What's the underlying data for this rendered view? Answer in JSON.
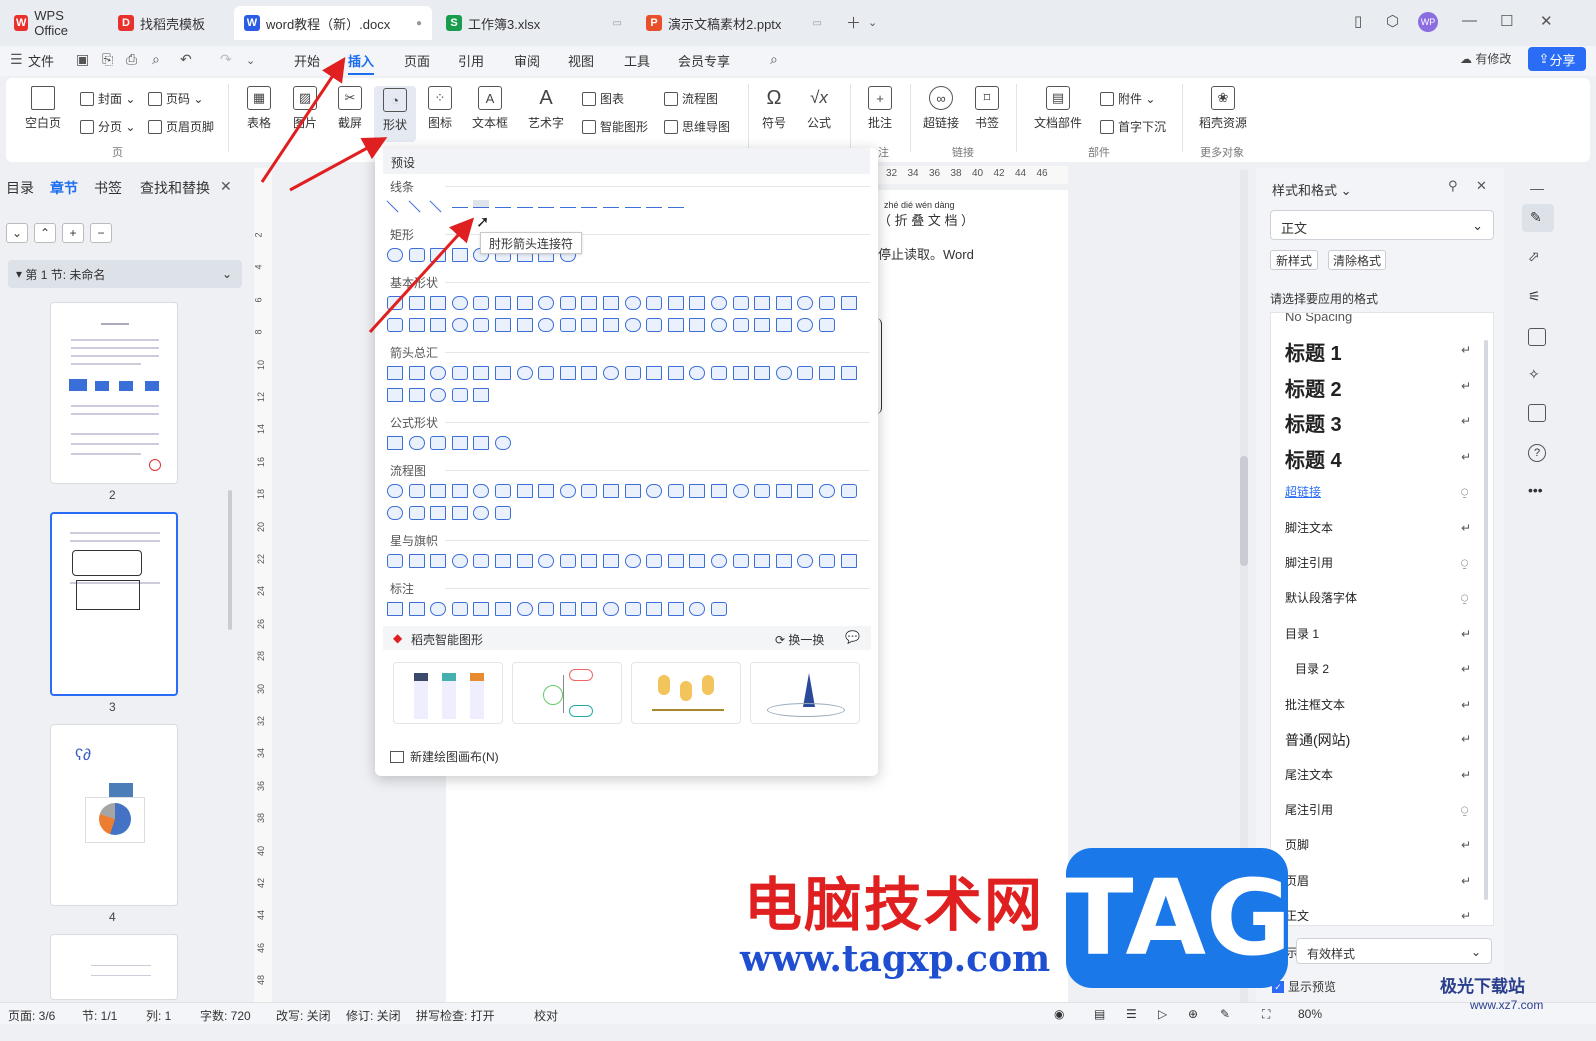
{
  "tabs": [
    {
      "label": "WPS Office",
      "color": "#e8302c"
    },
    {
      "label": "找稻壳模板",
      "color": "#e8302c"
    },
    {
      "label": "word教程（新）.docx",
      "color": "#2b5ce6"
    },
    {
      "label": "工作簿3.xlsx",
      "color": "#1a9c4f"
    },
    {
      "label": "演示文稿素材2.pptx",
      "color": "#e8502c"
    }
  ],
  "menu": {
    "file": "文件",
    "items": [
      "开始",
      "插入",
      "页面",
      "引用",
      "审阅",
      "视图",
      "工具",
      "会员专享"
    ],
    "modified": "有修改",
    "share": "分享"
  },
  "ribbon": {
    "blank_page": "空白页",
    "cover": "封面",
    "page_break": "分页",
    "page_number": "页码",
    "header_footer": "页眉页脚",
    "group_page": "页",
    "table": "表格",
    "picture": "图片",
    "screenshot": "截屏",
    "shape": "形状",
    "icon": "图标",
    "textbox": "文本框",
    "wordart": "艺术字",
    "chart": "图表",
    "smartart": "智能图形",
    "flowchart": "流程图",
    "mindmap": "思维导图",
    "symbol": "符号",
    "formula": "公式",
    "comment": "批注",
    "group_comment": "注",
    "hyperlink": "超链接",
    "bookmark": "书签",
    "group_link": "链接",
    "doc_parts": "文档部件",
    "attachment": "附件",
    "dropcap": "首字下沉",
    "group_parts": "部件",
    "docer_resource": "稻壳资源",
    "group_more": "更多对象"
  },
  "nav": {
    "tabs": [
      "目录",
      "章节",
      "书签",
      "查找和替换"
    ],
    "section": "第 1 节: 未命名",
    "pages": [
      "2",
      "3",
      "4"
    ]
  },
  "dropdown": {
    "header": "预设",
    "categories": [
      "线条",
      "矩形",
      "基本形状",
      "箭头总汇",
      "公式形状",
      "流程图",
      "星与旗帜",
      "标注"
    ],
    "tooltip": "肘形箭头连接符",
    "smart_title": "稻壳智能图形",
    "refresh": "换一换",
    "new_canvas": "新建绘图画布(N)"
  },
  "doc": {
    "ruby_line": "zhé dié wén dàng",
    "title_line": "（ 折 叠 文 档 ）",
    "body_line": "停止读取。Word"
  },
  "ruler_h": [
    "32",
    "34",
    "36",
    "38",
    "40",
    "42",
    "44",
    "46"
  ],
  "ruler_v": [
    "2",
    "4",
    "6",
    "8",
    "10",
    "12",
    "14",
    "16",
    "18",
    "20",
    "22",
    "24",
    "26",
    "28",
    "30",
    "32",
    "34",
    "36",
    "38",
    "40",
    "42",
    "44",
    "46",
    "48"
  ],
  "styles": {
    "title": "样式和格式",
    "current": "正文",
    "new_style": "新样式",
    "clear_format": "清除格式",
    "choose_label": "请选择要应用的格式",
    "list": [
      {
        "name": "No Spacing"
      },
      {
        "name": "标题 1"
      },
      {
        "name": "标题 2"
      },
      {
        "name": "标题 3"
      },
      {
        "name": "标题 4"
      },
      {
        "name": "超链接"
      },
      {
        "name": "脚注文本"
      },
      {
        "name": "脚注引用"
      },
      {
        "name": "默认段落字体"
      },
      {
        "name": "目录 1"
      },
      {
        "name": "目录 2"
      },
      {
        "name": "批注框文本"
      },
      {
        "name": "普通(网站)"
      },
      {
        "name": "尾注文本"
      },
      {
        "name": "尾注引用"
      },
      {
        "name": "页脚"
      },
      {
        "name": "页眉"
      },
      {
        "name": "正文"
      }
    ],
    "show_label": "显示",
    "show_value": "有效样式",
    "preview": "显示预览"
  },
  "status": {
    "page": "页面: 3/6",
    "section": "节: 1/1",
    "column": "列: 1",
    "words": "字数: 720",
    "rewrite": "改写: 关闭",
    "revise": "修订: 关闭",
    "spell": "拼写检查: 打开",
    "proof": "校对",
    "zoom": "80%"
  },
  "watermark": {
    "cn": "电脑技术网",
    "url": "www.tagxp.com",
    "tag": "TAG",
    "jg": "极光下载站",
    "jg_url": "www.xz7.com"
  }
}
